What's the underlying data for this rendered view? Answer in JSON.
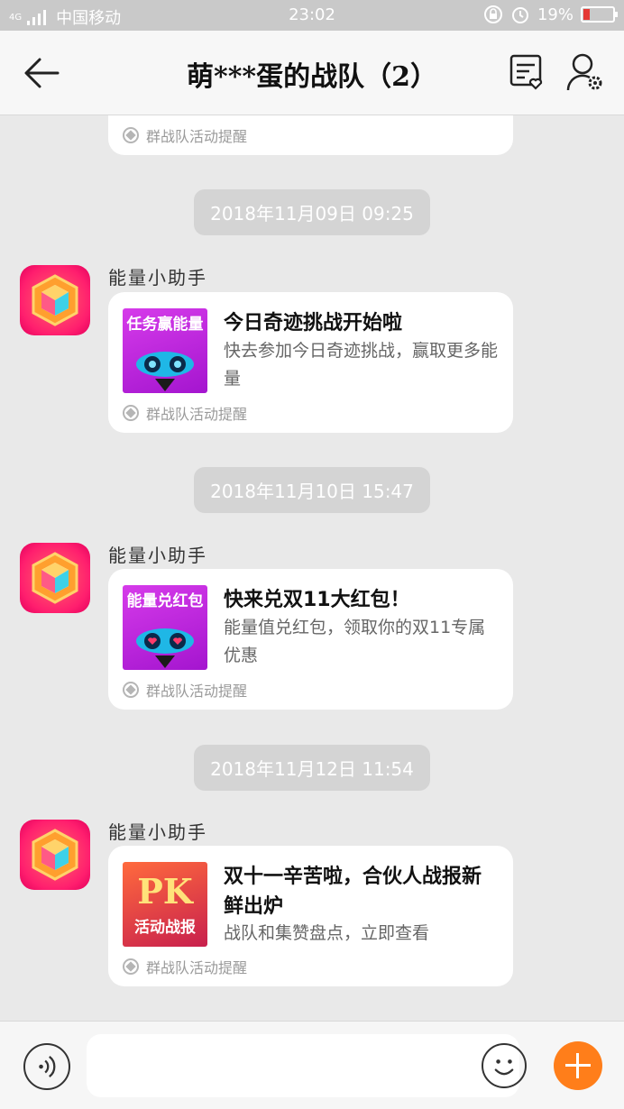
{
  "status_bar": {
    "carrier": "中国移动",
    "network": "4G",
    "time": "23:02",
    "battery": "19%"
  },
  "header": {
    "title": "萌***蛋的战队（2）"
  },
  "chat": {
    "partial_footer": "群战队活动提醒",
    "messages": [
      {
        "timestamp": "2018年11月09日 09:25",
        "sender": "能量小助手",
        "thumb_label": "任务赢能量",
        "title": "今日奇迹挑战开始啦",
        "description": "快去参加今日奇迹挑战，赢取更多能量",
        "footer": "群战队活动提醒"
      },
      {
        "timestamp": "2018年11月10日 15:47",
        "sender": "能量小助手",
        "thumb_label": "能量兑红包",
        "title": "快来兑双11大红包！",
        "description": "能量值兑红包，领取你的双11专属优惠",
        "footer": "群战队活动提醒"
      },
      {
        "timestamp": "2018年11月12日 11:54",
        "sender": "能量小助手",
        "thumb_label": "PK",
        "thumb_sublabel": "活动战报",
        "title": "双十一辛苦啦，合伙人战报新鲜出炉",
        "description": "战队和集赞盘点，立即查看",
        "footer": "群战队活动提醒"
      }
    ]
  },
  "input": {
    "placeholder": ""
  },
  "colors": {
    "accent": "#ff7e1a",
    "avatar": "#ff1e6e",
    "thumb_purple": "#b21ed8"
  },
  "icons": [
    "back-arrow-icon",
    "group-notice-icon",
    "member-settings-icon",
    "voice-icon",
    "emoji-icon",
    "plus-icon"
  ]
}
